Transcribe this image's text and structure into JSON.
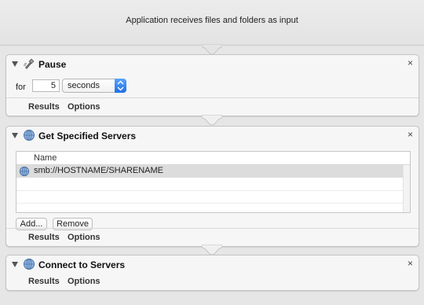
{
  "workflow": {
    "input_label": "Application receives files and folders as input"
  },
  "pause": {
    "title": "Pause",
    "for_label": "for",
    "amount": "5",
    "unit": "seconds",
    "footer": {
      "results": "Results",
      "options": "Options"
    }
  },
  "servers": {
    "title": "Get Specified Servers",
    "column_header": "Name",
    "rows": [
      "smb://HOSTNAME/SHARENAME"
    ],
    "add_label": "Add...",
    "remove_label": "Remove",
    "footer": {
      "results": "Results",
      "options": "Options"
    }
  },
  "connect": {
    "title": "Connect to Servers",
    "footer": {
      "results": "Results",
      "options": "Options"
    }
  },
  "icons": {
    "collapse": "disclosure-triangle-icon",
    "pause_action": "pause-action-icon",
    "globe": "network-globe-icon",
    "close": "close-icon",
    "stepper": "select-arrows-icon"
  },
  "colors": {
    "stepper_accent": "#2f7df0",
    "selected_row": "#dcdcdc"
  }
}
